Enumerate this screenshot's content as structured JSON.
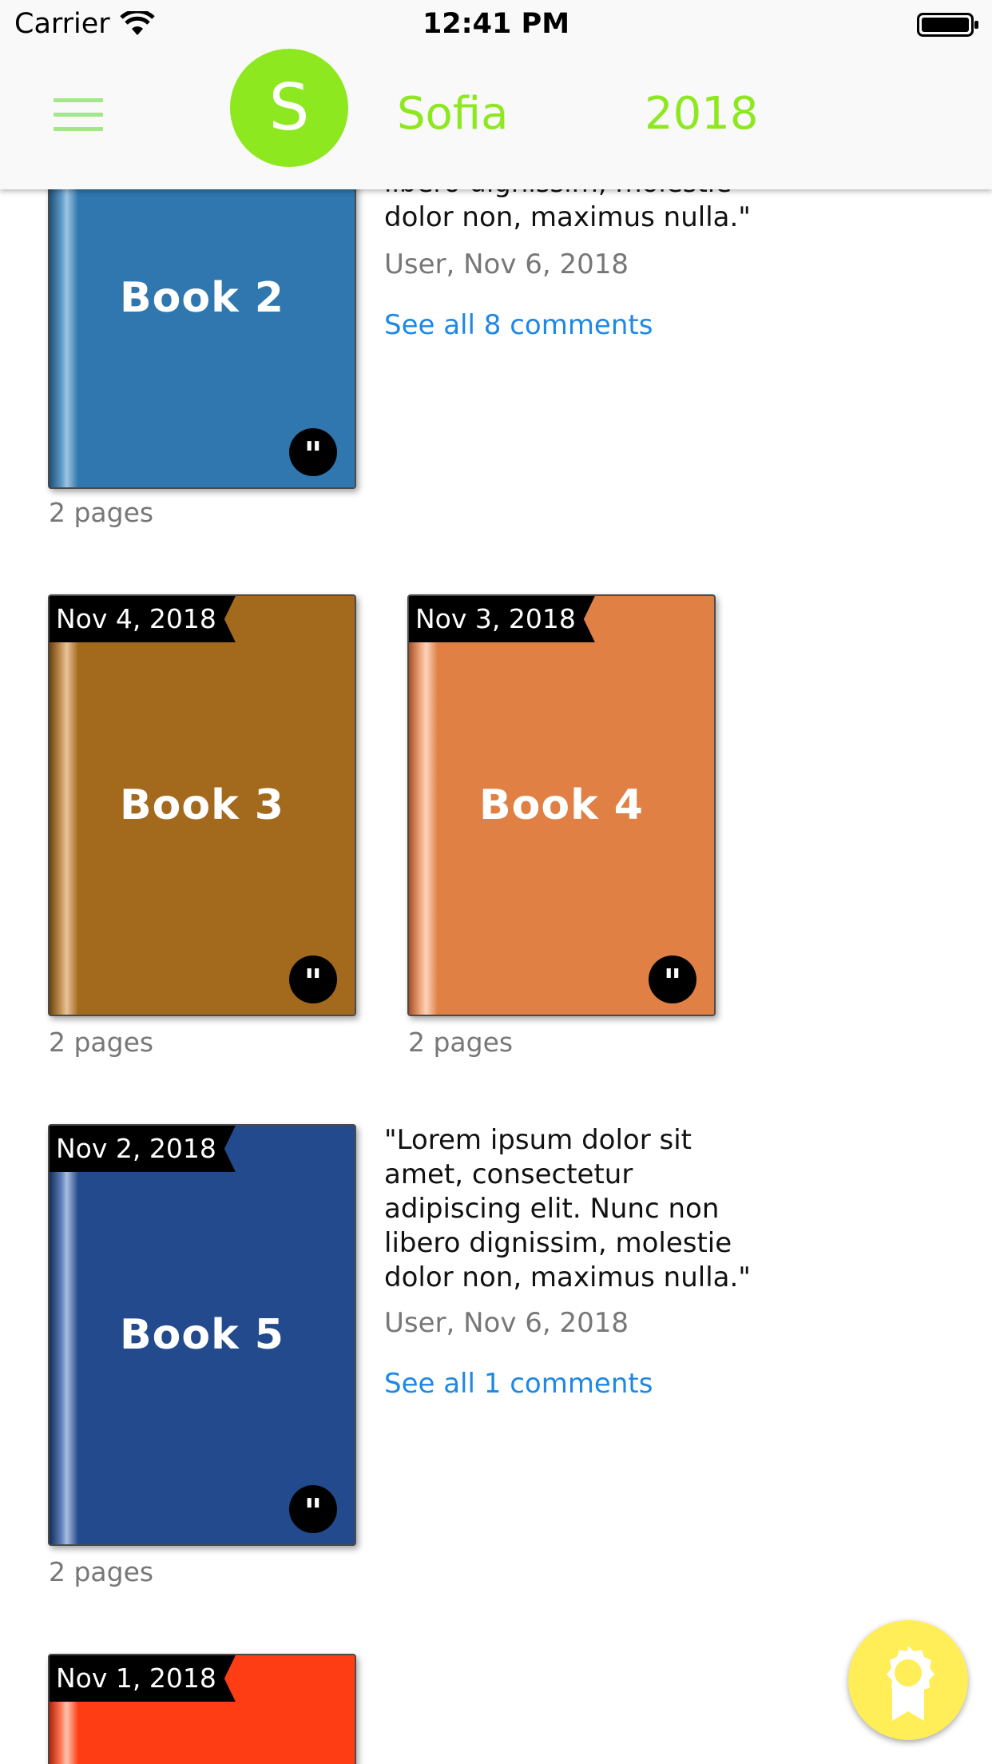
{
  "status_bar": {
    "carrier": "Carrier",
    "time": "12:41 PM"
  },
  "header": {
    "avatar_letter": "S",
    "username": "Sofia",
    "year": "2018"
  },
  "books": [
    {
      "title": "Book 2",
      "date": "",
      "pages": "2 pages",
      "color": "#2f77ae",
      "spine_color": "#5a97c4"
    },
    {
      "title": "Book 3",
      "date": "Nov 4, 2018",
      "pages": "2 pages",
      "color": "#a36a1e",
      "spine_color": "#c8955a"
    },
    {
      "title": "Book 4",
      "date": "Nov 3, 2018",
      "pages": "2 pages",
      "color": "#e08045",
      "spine_color": "#f1a97d"
    },
    {
      "title": "Book 5",
      "date": "Nov 2, 2018",
      "pages": "2 pages",
      "color": "#224a8c",
      "spine_color": "#5a7cb8"
    },
    {
      "title": "",
      "date": "Nov 1, 2018",
      "pages": "",
      "color": "#ff3d15",
      "spine_color": "#ff7a5a"
    }
  ],
  "comments": [
    {
      "text_partial": "libero dignissim, molestie\ndolor non, maximus nulla.\"",
      "meta": "User, Nov 6, 2018",
      "link": "See all 8 comments"
    },
    {
      "text": "\"Lorem ipsum dolor sit\namet, consectetur\nadipiscing elit. Nunc non\nlibero dignissim, molestie\ndolor non, maximus nulla.\"",
      "meta": "User, Nov 6, 2018",
      "link": "See all 1 comments"
    }
  ],
  "icons": {
    "menu": "hamburger-menu-icon",
    "quote": "quote-icon",
    "award": "award-ribbon-icon",
    "wifi": "wifi-icon",
    "battery": "battery-icon"
  },
  "colors": {
    "accent": "#8ee820",
    "link": "#1e88e5",
    "fab": "#ffee58"
  }
}
